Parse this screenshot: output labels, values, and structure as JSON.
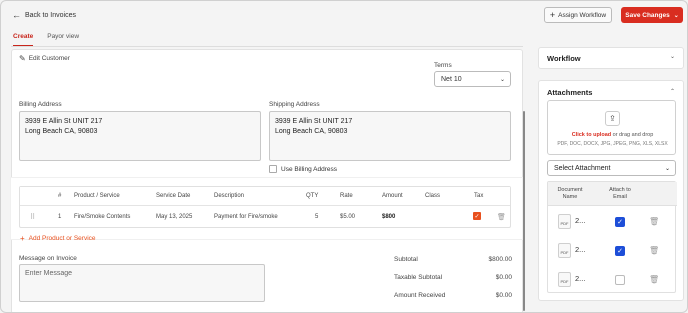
{
  "nav": {
    "back_label": "Back to Invoices"
  },
  "tabs": [
    {
      "label": "Create",
      "active": true
    },
    {
      "label": "Payor view",
      "active": false
    }
  ],
  "actions": {
    "assign_label": "Assign Workflow",
    "save_label": "Save Changes"
  },
  "customer": {
    "edit_label": "Edit Customer",
    "terms_label": "Terms",
    "terms_value": "Net 10",
    "billing_label": "Billing Address",
    "billing_line1": "3939 E Allin St UNIT 217",
    "billing_line2": "Long Beach CA, 90803",
    "shipping_label": "Shipping Address",
    "shipping_line1": "3939 E Allin St UNIT 217",
    "shipping_line2": "Long Beach CA, 90803",
    "use_billing_label": "Use Billing Address"
  },
  "line_items": {
    "headers": [
      "#",
      "Product / Service",
      "Service Date",
      "Description",
      "QTY",
      "Rate",
      "Amount",
      "Class",
      "Tax"
    ],
    "rows": [
      {
        "num": "1",
        "product": "Fire/Smoke Contents",
        "date": "May 13, 2025",
        "description": "Payment for Fire/smoke",
        "qty": "5",
        "rate": "$5.00",
        "amount": "$800",
        "class": "",
        "tax": true
      }
    ],
    "add_label": "Add Product or Service"
  },
  "message": {
    "label": "Message on Invoice",
    "placeholder": "Enter Message"
  },
  "totals": [
    {
      "label": "Subtotal",
      "value": "$800.00"
    },
    {
      "label": "Taxable Subtotal",
      "value": "$0.00"
    },
    {
      "label": "Amount Received",
      "value": "$0.00"
    }
  ],
  "sidebar": {
    "workflow_title": "Workflow",
    "attachments_title": "Attachments",
    "upload_link": "Click to upload",
    "upload_rest": " or drag and drop",
    "upload_formats": "PDF, DOC, DOCX, JPG, JPEG, PNG, XLS, XLSX",
    "select_attachment": "Select Attachment",
    "table_headers": {
      "doc_name": "Document Name",
      "attach_email": "Attach to Email"
    },
    "files": [
      {
        "type": "PDF",
        "name": "2...",
        "attach": true
      },
      {
        "type": "PDF",
        "name": "2...",
        "attach": true
      },
      {
        "type": "PDF",
        "name": "2...",
        "attach": false
      }
    ]
  },
  "colors": {
    "accent": "#d92d20",
    "tax_check": "#e8501e",
    "email_check": "#1d4ed8"
  }
}
